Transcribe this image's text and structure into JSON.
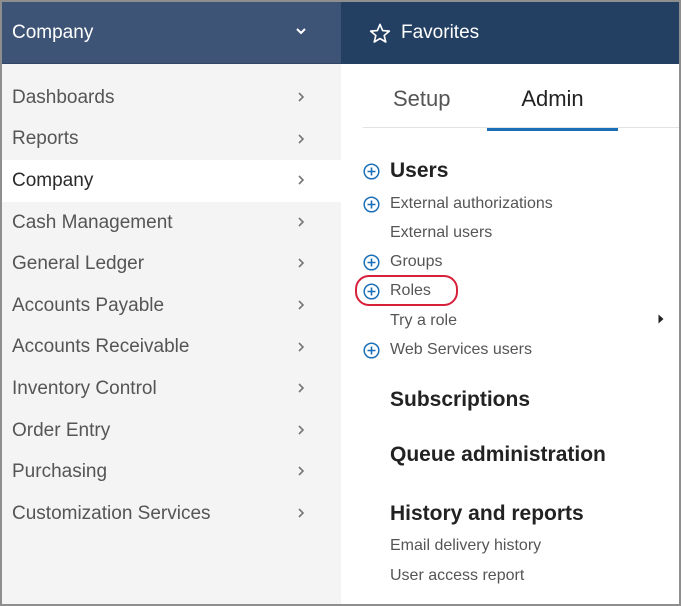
{
  "left_header": {
    "title": "Company"
  },
  "left_menu": [
    {
      "label": "Dashboards"
    },
    {
      "label": "Reports"
    },
    {
      "label": "Company"
    },
    {
      "label": "Cash Management"
    },
    {
      "label": "General Ledger"
    },
    {
      "label": "Accounts Payable"
    },
    {
      "label": "Accounts Receivable"
    },
    {
      "label": "Inventory Control"
    },
    {
      "label": "Order Entry"
    },
    {
      "label": "Purchasing"
    },
    {
      "label": "Customization Services"
    }
  ],
  "favorites": {
    "label": "Favorites"
  },
  "tabs": [
    {
      "label": "Setup"
    },
    {
      "label": "Admin"
    }
  ],
  "admin": {
    "users": "Users",
    "external_authorizations": "External authorizations",
    "external_users": "External users",
    "groups": "Groups",
    "roles": "Roles",
    "try_a_role": "Try a role",
    "web_services_users": "Web Services users",
    "subscriptions": "Subscriptions",
    "queue_administration": "Queue administration",
    "history_and_reports": "History and reports",
    "email_delivery_history": "Email delivery history",
    "user_access_report": "User access report"
  },
  "colors": {
    "left_header_bg": "#3e5476",
    "favorites_header_bg": "#233f61",
    "tab_underline": "#1b6fb8",
    "plus_icon": "#1b6fb8",
    "highlight_oval": "#d8203b"
  }
}
